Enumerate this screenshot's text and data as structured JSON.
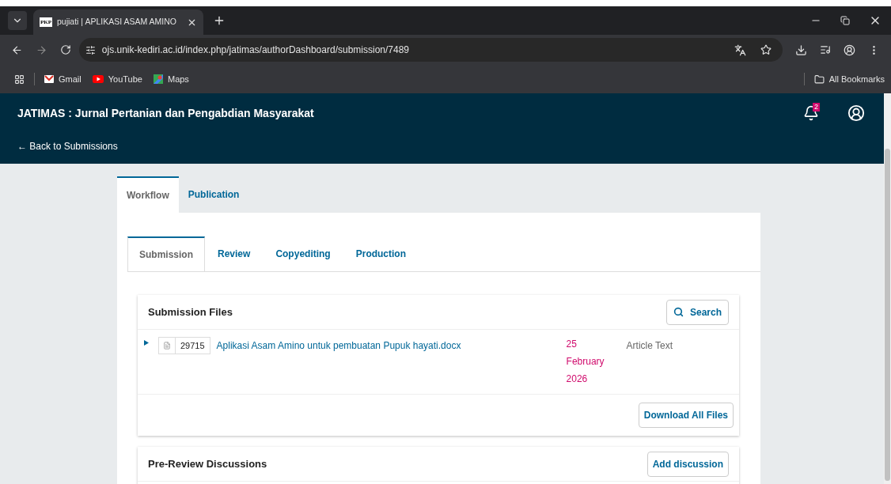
{
  "browser": {
    "tab_title": "pujiati | APLIKASI ASAM AMINO",
    "favicon_text": "PKP",
    "url": "ojs.unik-kediri.ac.id/index.php/jatimas/authorDashboard/submission/7489",
    "bookmarks": [
      "Gmail",
      "YouTube",
      "Maps"
    ],
    "all_bookmarks": "All Bookmarks"
  },
  "header": {
    "journal_title": "JATIMAS : Jurnal Pertanian dan Pengabdian Masyarakat",
    "back_link": "← Back to Submissions",
    "notification_count": "2"
  },
  "main_tabs": [
    {
      "label": "Workflow",
      "selected": true
    },
    {
      "label": "Publication",
      "selected": false
    }
  ],
  "stage_tabs": [
    {
      "label": "Submission",
      "selected": true
    },
    {
      "label": "Review",
      "selected": false
    },
    {
      "label": "Copyediting",
      "selected": false
    },
    {
      "label": "Production",
      "selected": false
    }
  ],
  "submission_files": {
    "title": "Submission Files",
    "search_button": "Search",
    "files": [
      {
        "id": "29715",
        "name": "Aplikasi Asam Amino untuk pembuatan Pupuk hayati.docx",
        "date": "25 February 2026",
        "type": "Article Text",
        "expanded": false
      }
    ],
    "download_button": "Download All Files"
  },
  "discussions": {
    "title": "Pre-Review Discussions",
    "add_button": "Add discussion"
  }
}
